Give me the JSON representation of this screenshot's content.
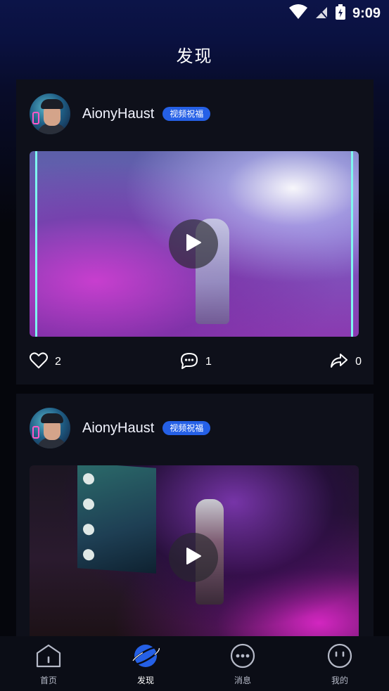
{
  "status": {
    "time": "9:09"
  },
  "header": {
    "title": "发现"
  },
  "posts": [
    {
      "username": "AionyHaust",
      "tag": "视频祝福",
      "likes": "2",
      "comments": "1",
      "shares": "0"
    },
    {
      "username": "AionyHaust",
      "tag": "视频祝福"
    }
  ],
  "tabbar": {
    "items": [
      {
        "label": "首页",
        "icon": "home-icon"
      },
      {
        "label": "发现",
        "icon": "planet-icon",
        "active": true
      },
      {
        "label": "消息",
        "icon": "chat-icon"
      },
      {
        "label": "我的",
        "icon": "face-icon"
      }
    ]
  },
  "colors": {
    "accent": "#2560e6",
    "card": "#0e101a",
    "background": "#05060c"
  }
}
